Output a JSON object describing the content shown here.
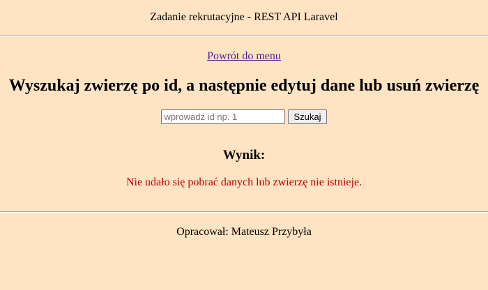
{
  "header": {
    "title": "Zadanie rekrutacyjne - REST API Laravel"
  },
  "nav": {
    "back_link": "Powrót do menu"
  },
  "main": {
    "title": "Wyszukaj zwierzę po id, a następnie edytuj dane lub usuń zwierzę",
    "search": {
      "value": "",
      "placeholder": "wprowadź id np. 1",
      "button_label": "Szukaj"
    },
    "result": {
      "heading": "Wynik:",
      "message": "Nie udało się pobrać danych lub zwierzę nie istnieje."
    }
  },
  "footer": {
    "author": "Opracował: Mateusz Przybyła"
  },
  "colors": {
    "background": "#ffe4c4",
    "link": "#551a8b",
    "error": "#c00000"
  }
}
